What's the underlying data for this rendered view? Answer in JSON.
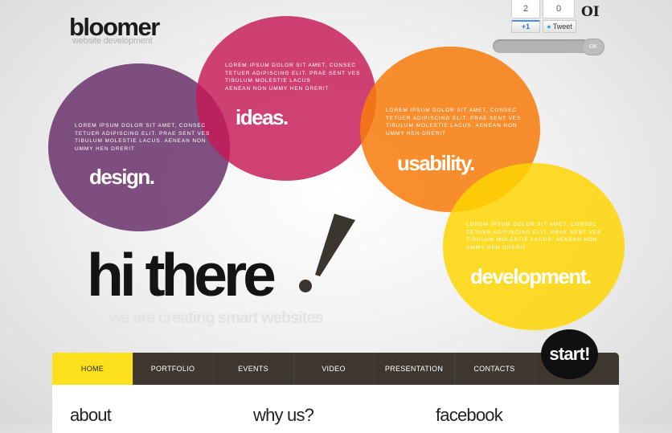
{
  "logo": {
    "title": "bloomer",
    "subtitle": "website development"
  },
  "social": {
    "plus_count": "2",
    "plus_label": "+1",
    "tweet_count": "0",
    "tweet_label": "Tweet",
    "mark": "OI"
  },
  "search": {
    "placeholder": "",
    "ok_label": "OK"
  },
  "bubbles": [
    {
      "text": "Lorem ipsum dolor sit amet, consec\ntetuer adipiscing elit. Prae sent ves\ntibulum molestie lacus. Aenean non\nummy hen drerit",
      "word": "design.",
      "color": "#672e68"
    },
    {
      "text": "Lorem ipsum dolor sit amet, consec\ntetuer adipiscing elit. Prae sent ves\ntibulum molestie lacus\naenean non ummy hen drerit",
      "word": "ideas.",
      "color": "#c71856"
    },
    {
      "text": "Lorem ipsum dolor sit amet, consec\ntetuer adipiscing elit. Prae sent ves\ntibulum molestie lacus. Aenean non\nummy hen drerit",
      "word": "usability.",
      "color": "#f77c0a"
    },
    {
      "text": "Lorem ipsum dolor sit amet, consec\ntetuer adipiscing elit. Prae sent ves\ntibulum molestie lacus. Aenean non\nummy hen drerit",
      "word": "development.",
      "color": "#fed500"
    }
  ],
  "hero": {
    "headline": "hi there",
    "tagline": "we are creating smart websites"
  },
  "nav": {
    "items": [
      "Home",
      "Portfolio",
      "Events",
      "Video",
      "Presentation",
      "Contacts"
    ],
    "active": "Home",
    "start_label": "start!"
  },
  "sections": {
    "about": "about",
    "why_us": "why us?",
    "facebook": "facebook"
  },
  "colors": {
    "accent_yellow": "#fde01c",
    "nav_background": "#3d3730"
  }
}
